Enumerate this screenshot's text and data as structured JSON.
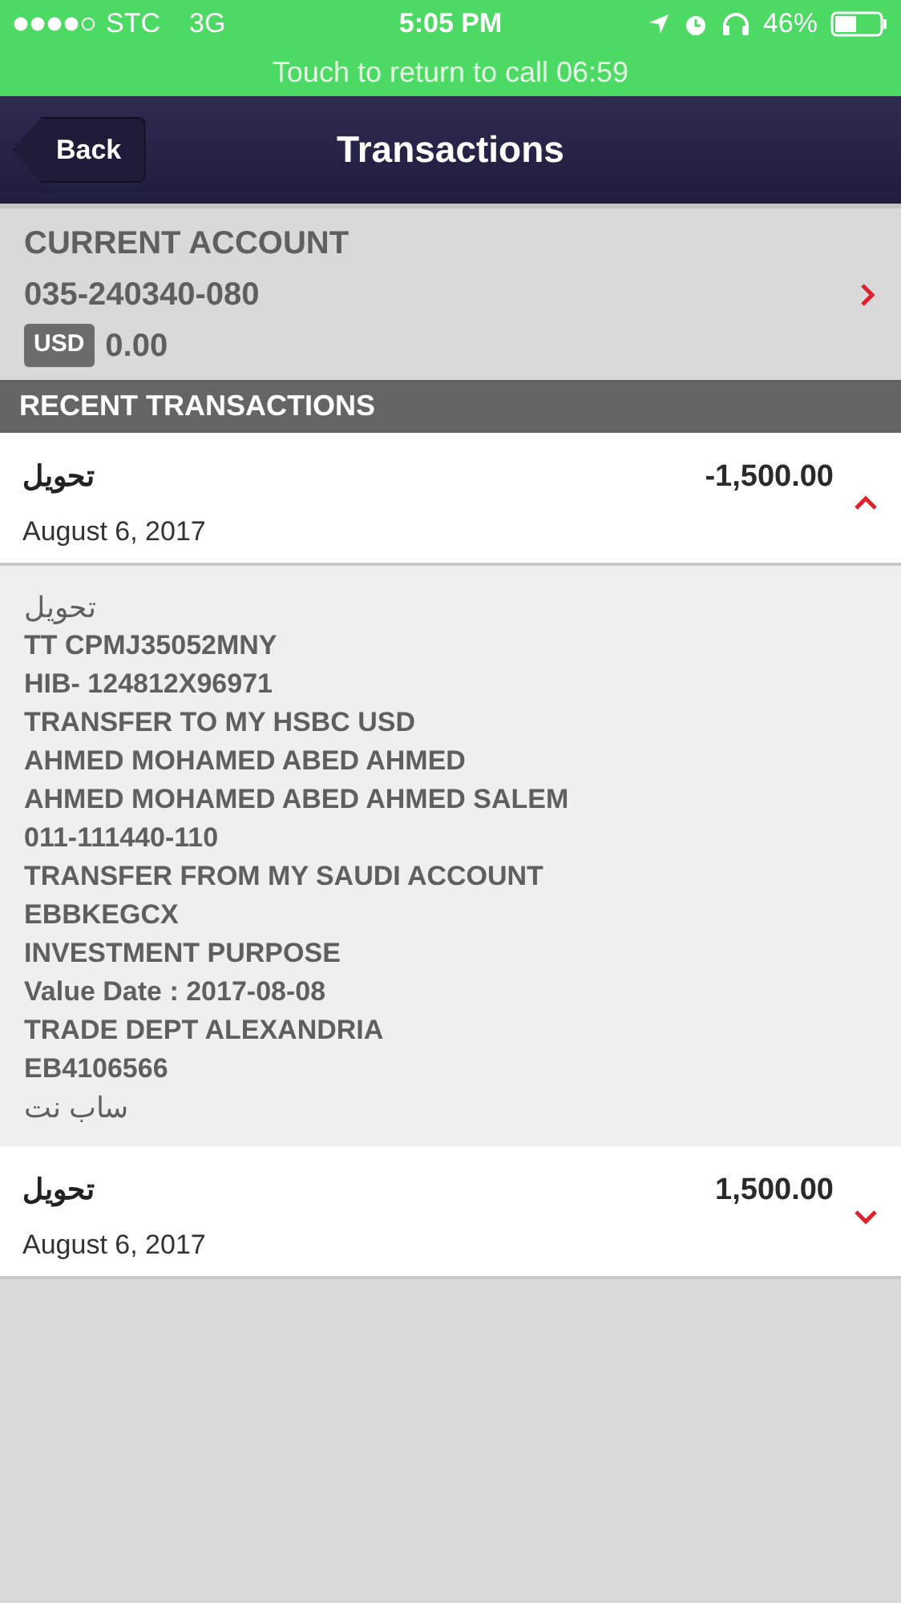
{
  "status_bar": {
    "carrier": "STC",
    "network": "3G",
    "time": "5:05 PM",
    "battery": "46%"
  },
  "call_banner": {
    "text": "Touch to return to call 06:59"
  },
  "nav": {
    "back": "Back",
    "title": "Transactions"
  },
  "account": {
    "name": "CURRENT ACCOUNT",
    "number": "035-240340-080",
    "currency": "USD",
    "balance": "0.00"
  },
  "section_header": "RECENT TRANSACTIONS",
  "transactions": [
    {
      "description": "تحويل",
      "date": "August 6, 2017",
      "amount": "-1,500.00",
      "expanded": true,
      "details": [
        {
          "kind": "plain",
          "text": "تحويل"
        },
        {
          "kind": "bold",
          "text": "TT CPMJ35052MNY"
        },
        {
          "kind": "bold",
          "text": "HIB- 124812X96971"
        },
        {
          "kind": "bold",
          "text": "TRANSFER TO MY HSBC USD"
        },
        {
          "kind": "bold",
          "text": "AHMED MOHAMED ABED AHMED"
        },
        {
          "kind": "bold",
          "text": "AHMED MOHAMED ABED AHMED SALEM"
        },
        {
          "kind": "bold",
          "text": "011-111440-110"
        },
        {
          "kind": "bold",
          "text": "TRANSFER FROM MY SAUDI ACCOUNT"
        },
        {
          "kind": "bold",
          "text": "EBBKEGCX"
        },
        {
          "kind": "bold",
          "text": "INVESTMENT PURPOSE"
        },
        {
          "kind": "bold",
          "text": "Value Date : 2017-08-08"
        },
        {
          "kind": "bold",
          "text": "TRADE DEPT ALEXANDRIA"
        },
        {
          "kind": "bold",
          "text": "EB4106566"
        },
        {
          "kind": "plain",
          "text": "ساب نت"
        }
      ]
    },
    {
      "description": "تحويل",
      "date": "August 6, 2017",
      "amount": "1,500.00",
      "expanded": false
    }
  ]
}
